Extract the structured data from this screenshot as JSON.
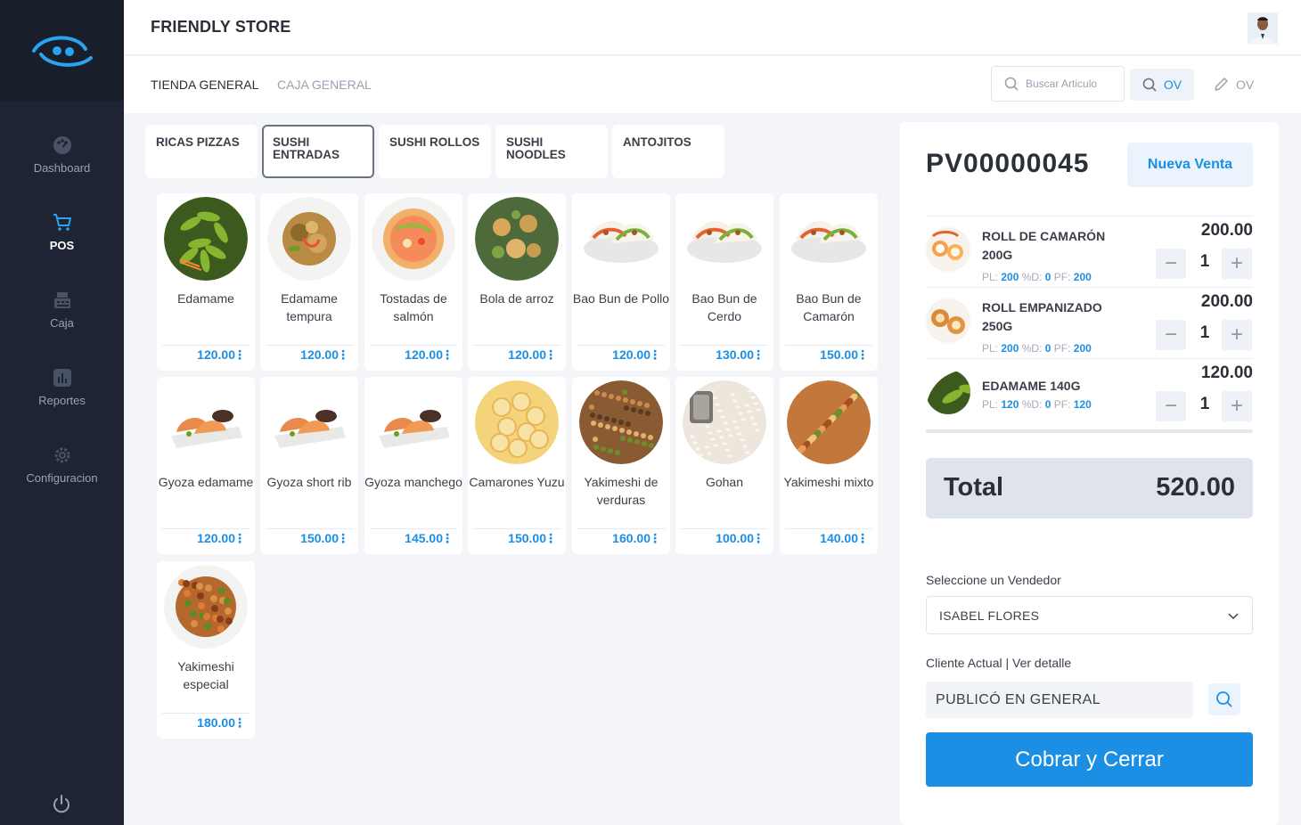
{
  "app": {
    "store_name": "FRIENDLY STORE"
  },
  "sidebar": {
    "items": [
      {
        "label": "Dashboard",
        "icon": "dashboard-icon"
      },
      {
        "label": "POS",
        "icon": "cart-icon",
        "active": true
      },
      {
        "label": "Caja",
        "icon": "register-icon"
      },
      {
        "label": "Reportes",
        "icon": "reports-icon"
      },
      {
        "label": "Configuracion",
        "icon": "gear-icon"
      }
    ]
  },
  "breadcrumb": {
    "store": "TIENDA GENERAL",
    "register": "CAJA GENERAL"
  },
  "toolbar": {
    "search_placeholder": "Buscar Articulo",
    "ov_search_label": "OV",
    "ov_edit_label": "OV"
  },
  "categories": [
    {
      "label": "RICAS PIZZAS"
    },
    {
      "label": "SUSHI ENTRADAS",
      "active": true
    },
    {
      "label": "SUSHI ROLLOS"
    },
    {
      "label": "SUSHI NOODLES"
    },
    {
      "label": "ANTOJITOS"
    }
  ],
  "products": [
    {
      "name": "Edamame",
      "price": "120.00",
      "image": "edamame"
    },
    {
      "name": "Edamame tempura",
      "price": "120.00",
      "image": "tempura"
    },
    {
      "name": "Tostadas de salmón",
      "price": "120.00",
      "image": "tostada"
    },
    {
      "name": "Bola de arroz",
      "price": "120.00",
      "image": "rice-ball"
    },
    {
      "name": "Bao Bun de Pollo",
      "price": "120.00",
      "image": "bao"
    },
    {
      "name": "Bao Bun de Cerdo",
      "price": "130.00",
      "image": "bao"
    },
    {
      "name": "Bao Bun de Camarón",
      "price": "150.00",
      "image": "bao"
    },
    {
      "name": "Gyoza edamame",
      "price": "120.00",
      "image": "gyoza"
    },
    {
      "name": "Gyoza short rib",
      "price": "150.00",
      "image": "gyoza"
    },
    {
      "name": "Gyoza manchego",
      "price": "145.00",
      "image": "gyoza"
    },
    {
      "name": "Camarones Yuzu",
      "price": "150.00",
      "image": "shrimp"
    },
    {
      "name": "Yakimeshi de verduras",
      "price": "160.00",
      "image": "fried-rice"
    },
    {
      "name": "Gohan",
      "price": "100.00",
      "image": "gohan"
    },
    {
      "name": "Yakimeshi mixto",
      "price": "140.00",
      "image": "fried-rice-mix"
    },
    {
      "name": "Yakimeshi especial",
      "price": "180.00",
      "image": "especial"
    }
  ],
  "order": {
    "number": "PV00000045",
    "new_sale_label": "Nueva Venta",
    "lines": [
      {
        "name": "ROLL DE CAMARÓN 200G",
        "total": "200.00",
        "qty": "1",
        "pl": "200",
        "d": "0",
        "pf": "200",
        "image": "roll"
      },
      {
        "name": "ROLL EMPANIZADO 250G",
        "total": "200.00",
        "qty": "1",
        "pl": "200",
        "d": "0",
        "pf": "200",
        "image": "roll-fried"
      },
      {
        "name": "EDAMAME 140G",
        "total": "120.00",
        "qty": "1",
        "pl": "120",
        "d": "0",
        "pf": "120",
        "image": "edamame"
      }
    ],
    "meta_labels": {
      "pl": "PL:",
      "d": "%D:",
      "pf": "PF:"
    },
    "total_label": "Total",
    "total_value": "520.00",
    "seller_label": "Seleccione un Vendedor",
    "seller_value": "ISABEL FLORES",
    "client_label": "Cliente Actual | Ver detalle",
    "client_value": "PUBLICÓ EN GENERAL",
    "checkout_label": "Cobrar y Cerrar"
  },
  "colors": {
    "accent": "#1a8fe3",
    "sidebar": "#1e2433",
    "background": "#f3f5f8"
  }
}
